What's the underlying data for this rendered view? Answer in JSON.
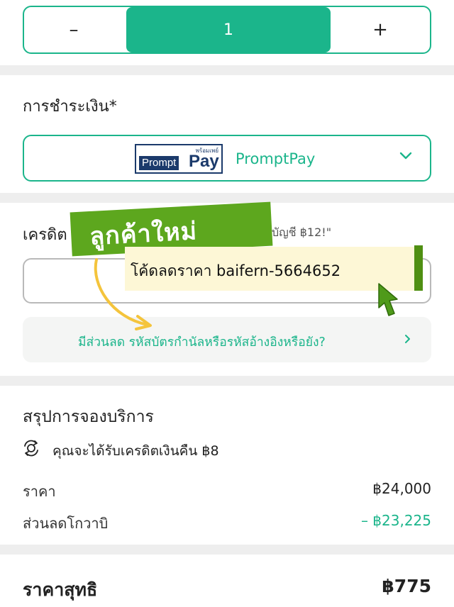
{
  "colors": {
    "accent": "#1bb58b",
    "sticker_green": "#5da71e",
    "sticker_cream": "#fdf7d6",
    "promptpay_navy": "#1b3a6b"
  },
  "quantity": {
    "minus_label": "–",
    "value": "1",
    "plus_label": "+"
  },
  "payment": {
    "heading": "การชำระเงิน*",
    "logo": {
      "thai": "พร้อมเพย์",
      "prompt": "Prompt",
      "pay": "Pay"
    },
    "selected": "PromptPay",
    "chevron_icon": "chevron-down-icon"
  },
  "credit": {
    "label": "เครดิต",
    "note": "บัญชี ฿12!\"",
    "input_value": ""
  },
  "promo": {
    "text": "มีส่วนลด รหัสบัตรกำนัลหรือรหัสอ้างอิงหรือยัง?",
    "chevron_icon": "chevron-right-icon"
  },
  "overlay": {
    "new_customer": "ลูกค้าใหม่",
    "code_text": "โค้ดลดราคา baifern-5664652"
  },
  "summary": {
    "title": "สรุปการจองบริการ",
    "cashback_icon": "coin-refresh-icon",
    "cashback_text": "คุณจะได้รับเครดิตเงินคืน ฿8",
    "rows": [
      {
        "label": "ราคา",
        "value": "฿24,000"
      },
      {
        "label": "ส่วนลดโกวาบิ",
        "value": "– ฿23,225"
      }
    ],
    "total_label": "ราคาสุทธิ",
    "total_value": "฿775"
  }
}
